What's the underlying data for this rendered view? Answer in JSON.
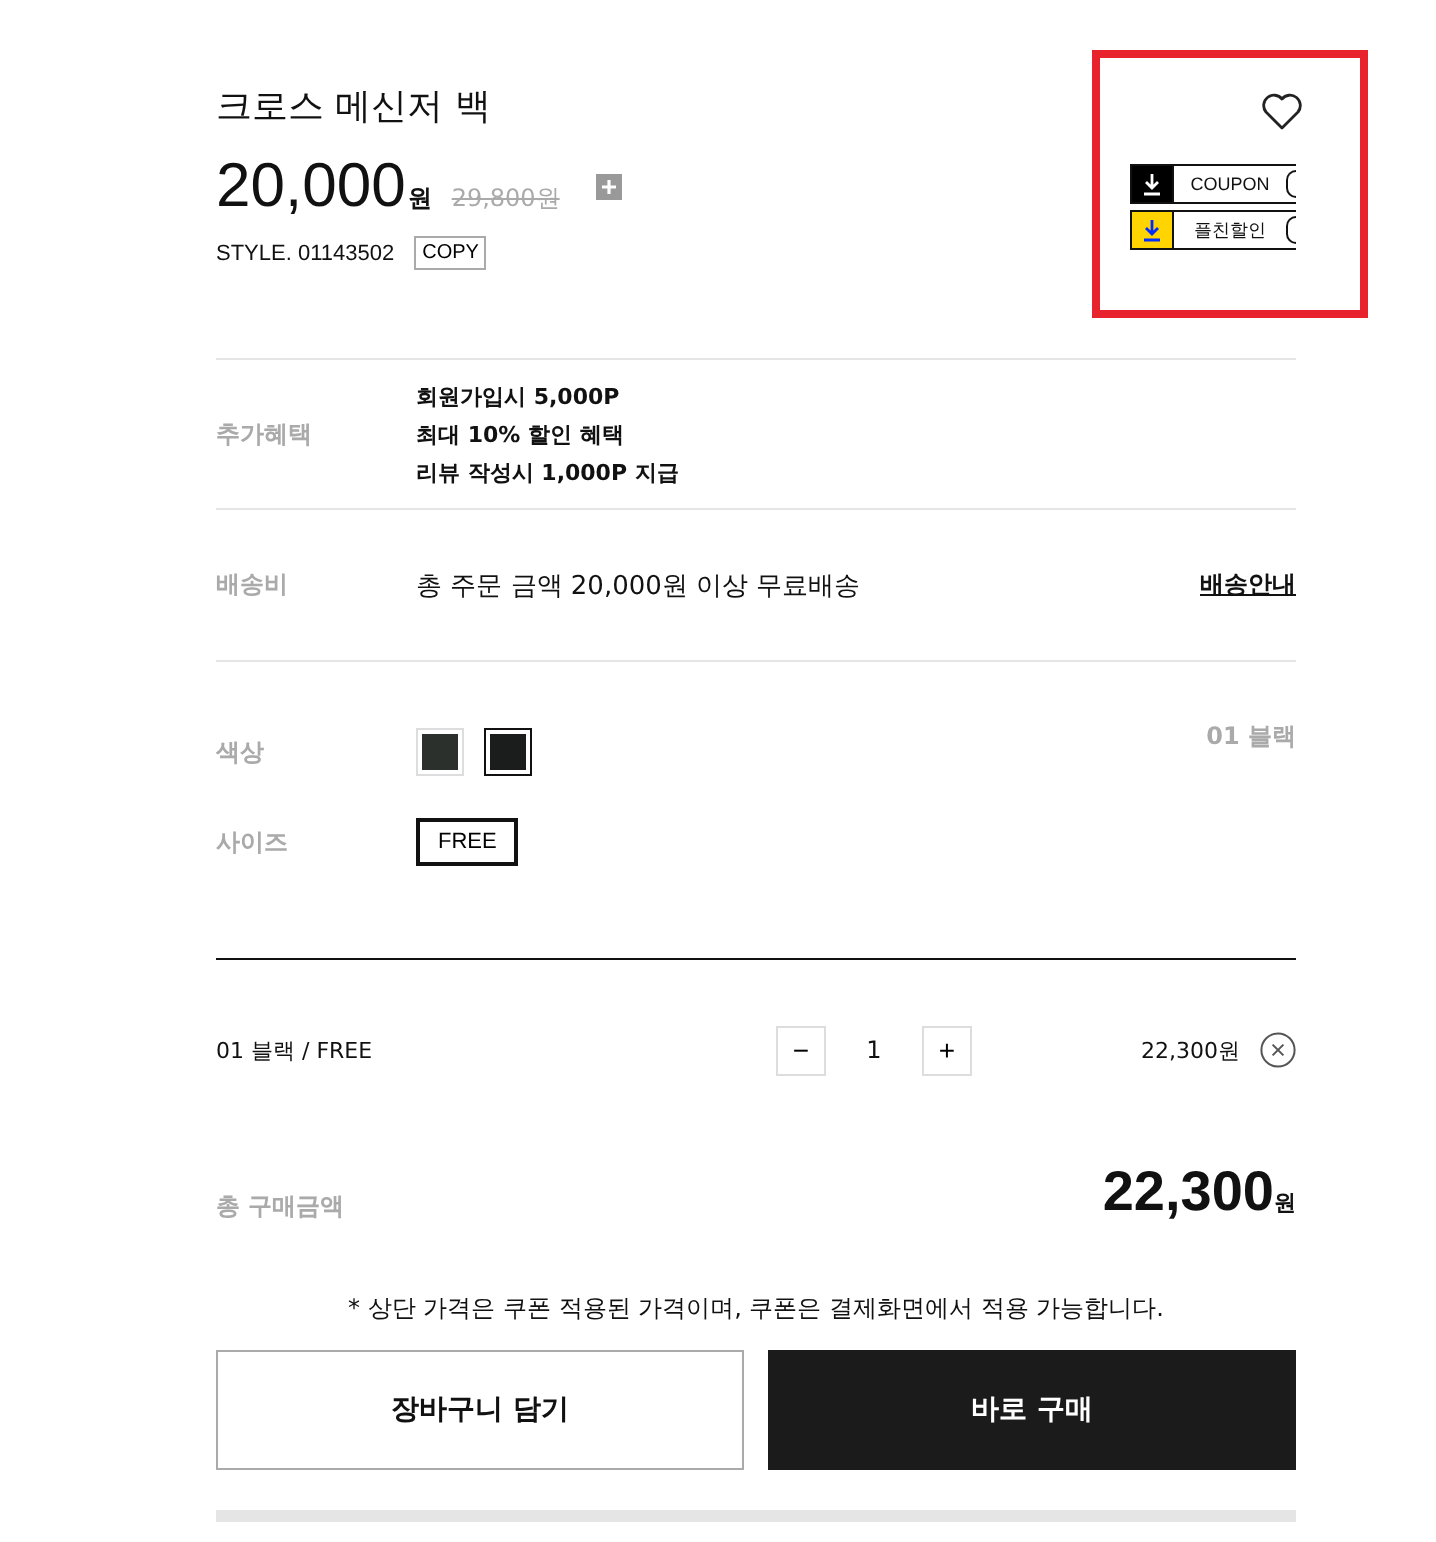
{
  "product": {
    "title": "크로스 메신저 백",
    "price": "20,000",
    "price_unit": "원",
    "original_price": "29,800원",
    "style_label": "STYLE. 01143502",
    "copy_button": "COPY"
  },
  "coupons": [
    {
      "label": "COUPON",
      "color": "#000000"
    },
    {
      "label": "플친할인",
      "color": "#ffd400"
    }
  ],
  "benefits": {
    "label": "추가혜택",
    "lines": [
      "회원가입시 5,000P",
      "최대 10% 할인 혜택",
      "리뷰 작성시 1,000P 지급"
    ]
  },
  "shipping": {
    "label": "배송비",
    "text": "총 주문 금액 20,000원 이상 무료배송",
    "link": "배송안내"
  },
  "color_option": {
    "label": "색상",
    "selected_name": "01 블랙",
    "swatches": [
      {
        "color": "#2b302d",
        "selected": false
      },
      {
        "color": "#1b1d1c",
        "selected": true
      }
    ]
  },
  "size_option": {
    "label": "사이즈",
    "choices": [
      {
        "label": "FREE",
        "selected": true
      }
    ]
  },
  "order_line": {
    "name": "01 블랙 / FREE",
    "minus": "−",
    "quantity": "1",
    "plus": "+",
    "price": "22,300원"
  },
  "total": {
    "label": "총 구매금액",
    "amount": "22,300",
    "unit": "원"
  },
  "note": "* 상단 가격은 쿠폰 적용된 가격이며, 쿠폰은 결제화면에서 적용 가능합니다.",
  "buttons": [
    {
      "label": "장바구니 담기",
      "kind": "outline"
    },
    {
      "label": "바로 구매",
      "kind": "solid"
    }
  ]
}
